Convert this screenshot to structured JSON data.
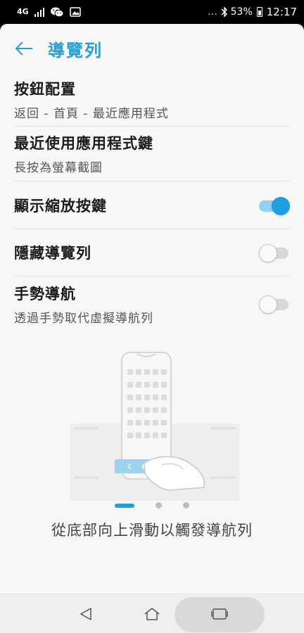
{
  "status_bar": {
    "network": "4G",
    "battery": "53%",
    "time": "12:17",
    "icons": [
      "wechat-icon",
      "gallery-icon",
      "more-dots-icon",
      "bluetooth-icon"
    ]
  },
  "header": {
    "title": "導覽列"
  },
  "settings": [
    {
      "title": "按鈕配置",
      "subtitle": "返回 - 首頁 - 最近應用程式"
    },
    {
      "title": "最近使用應用程式鍵",
      "subtitle": "長按為螢幕截圖"
    },
    {
      "title": "顯示縮放按鍵",
      "toggle": true
    },
    {
      "title": "隱藏導覽列",
      "toggle": false
    },
    {
      "title": "手勢導航",
      "subtitle": "透過手勢取代虛擬導航列",
      "toggle": false
    }
  ],
  "tutorial": {
    "caption": "從底部向上滑動以觸發導航列",
    "page_count": 3,
    "active_page": 1
  },
  "colors": {
    "accent": "#1f9ee0",
    "title": "#2a9fcf",
    "background": "#f7f7f7"
  },
  "nav_bar": {
    "buttons": [
      "back-icon",
      "home-icon",
      "recents-icon"
    ]
  }
}
